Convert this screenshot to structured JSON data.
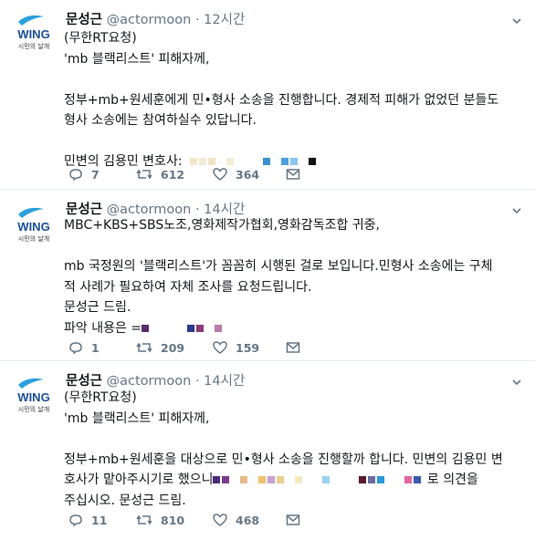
{
  "tweets": [
    {
      "name": "문성근",
      "handle": "@actormoon",
      "separator": "·",
      "time": "12시간",
      "avatar_logo": "WING",
      "avatar_sub": "시민의 날개",
      "lines": [
        "(무한RT요청)",
        "'mb 블랙리스트' 피해자께,",
        "",
        "정부+mb+원세훈에게 민•형사 소송을 진행합니다. 경제적 피해가 없었던 분들도",
        "형사 소송에는 참여하실수 있답니다.",
        "",
        "민변의 김용민 변호사:"
      ],
      "reply_count": "7",
      "retweet_count": "612",
      "like_count": "364"
    },
    {
      "name": "문성근",
      "handle": "@actormoon",
      "separator": "·",
      "time": "14시간",
      "avatar_logo": "WING",
      "avatar_sub": "시민의 날개",
      "lines": [
        "MBC+KBS+SBS노조,영화제작가협회,영화감독조합 귀중,",
        "",
        "mb 국정원의 '블랙리스트'가 꼼꼼히 시행된 걸로 보입니다.민형사 소송에는 구체",
        "적 사례가 필요하여 자체 조사를 요청드립니다.",
        "문성근 드림.",
        "파악 내용은 ="
      ],
      "reply_count": "1",
      "retweet_count": "209",
      "like_count": "159"
    },
    {
      "name": "문성근",
      "handle": "@actormoon",
      "separator": "·",
      "time": "14시간",
      "avatar_logo": "WING",
      "avatar_sub": "시민의 날개",
      "lines": [
        "(무한RT요청)",
        "'mb 블랙리스트' 피해자께,",
        "",
        "정부+mb+원세훈을 대상으로 민•형사 소송을 진행할까 합니다. 민변의 김용민 변",
        "호사가 맡아주시기로 했으니",
        "주십시오. 문성근 드림."
      ],
      "line_suffix": "로 의견을",
      "reply_count": "11",
      "retweet_count": "810",
      "like_count": "468"
    }
  ],
  "icons": {
    "reply": "reply-icon",
    "retweet": "retweet-icon",
    "like": "heart-icon",
    "dm": "envelope-icon",
    "caret": "chevron-down-icon"
  },
  "colors": {
    "text": "#14171a",
    "muted": "#657786",
    "border": "#e6ecf0",
    "wing_blue": "#1a4e9a"
  }
}
